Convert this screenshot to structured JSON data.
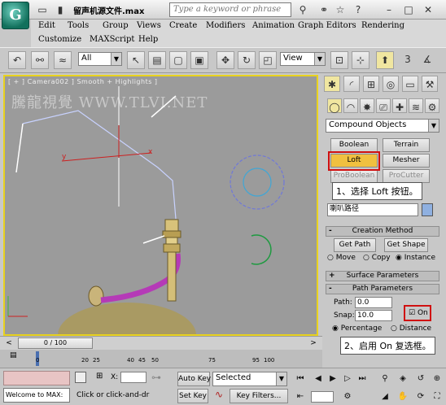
{
  "titlebar": {
    "filename": "留声机源文件.max",
    "search_placeholder": "Type a keyword or phrase"
  },
  "menu": [
    "Edit",
    "Tools",
    "Group",
    "Views",
    "Create",
    "Modifiers",
    "Animation",
    "Graph Editors",
    "Rendering",
    "Customize",
    "MAXScript",
    "Help"
  ],
  "toolbar": {
    "filter_value": "All",
    "coord_value": "View"
  },
  "viewport": {
    "label": "[ + ] Camera002 ] Smooth + Highlights ]",
    "watermark": "騰龍視覺 WWW.TLVI.NET",
    "axis_x": "x",
    "axis_y": "y"
  },
  "panel": {
    "category": "Compound Objects",
    "buttons": [
      "Boolean",
      "Terrain",
      "Loft",
      "Mesher",
      "ProBoolean",
      "ProCutter"
    ],
    "name_value": "喇叭路径",
    "rollouts": {
      "creation": "Creation Method",
      "surface": "Surface Parameters",
      "path": "Path Parameters"
    },
    "get_path": "Get Path",
    "get_shape": "Get Shape",
    "radio_move": "Move",
    "radio_copy": "Copy",
    "radio_instance": "Instance",
    "path_label": "Path:",
    "path_value": "0.0",
    "snap_label": "Snap:",
    "snap_value": "10.0",
    "on_label": "On",
    "percentage": "Percentage",
    "distance": "Distance"
  },
  "callouts": {
    "one": "1、选择 Loft 按钮。",
    "two": "2、启用 On 复选框。"
  },
  "timeline": {
    "frame": "0 / 100",
    "ticks": [
      "0",
      "20",
      "25",
      "40",
      "45",
      "50",
      "75",
      "95",
      "100"
    ]
  },
  "status": {
    "welcome": "Welcome to MAX:",
    "hint": "Click or click-and-dra",
    "x_label": "X:",
    "auto_key": "Auto Key",
    "key_mode": "Selected",
    "set_key": "Set Key",
    "key_filters": "Key Filters..."
  },
  "colors": {
    "viewport_border": "#e8d21e",
    "highlight": "#d01010",
    "loft_button": "#f0c040"
  }
}
